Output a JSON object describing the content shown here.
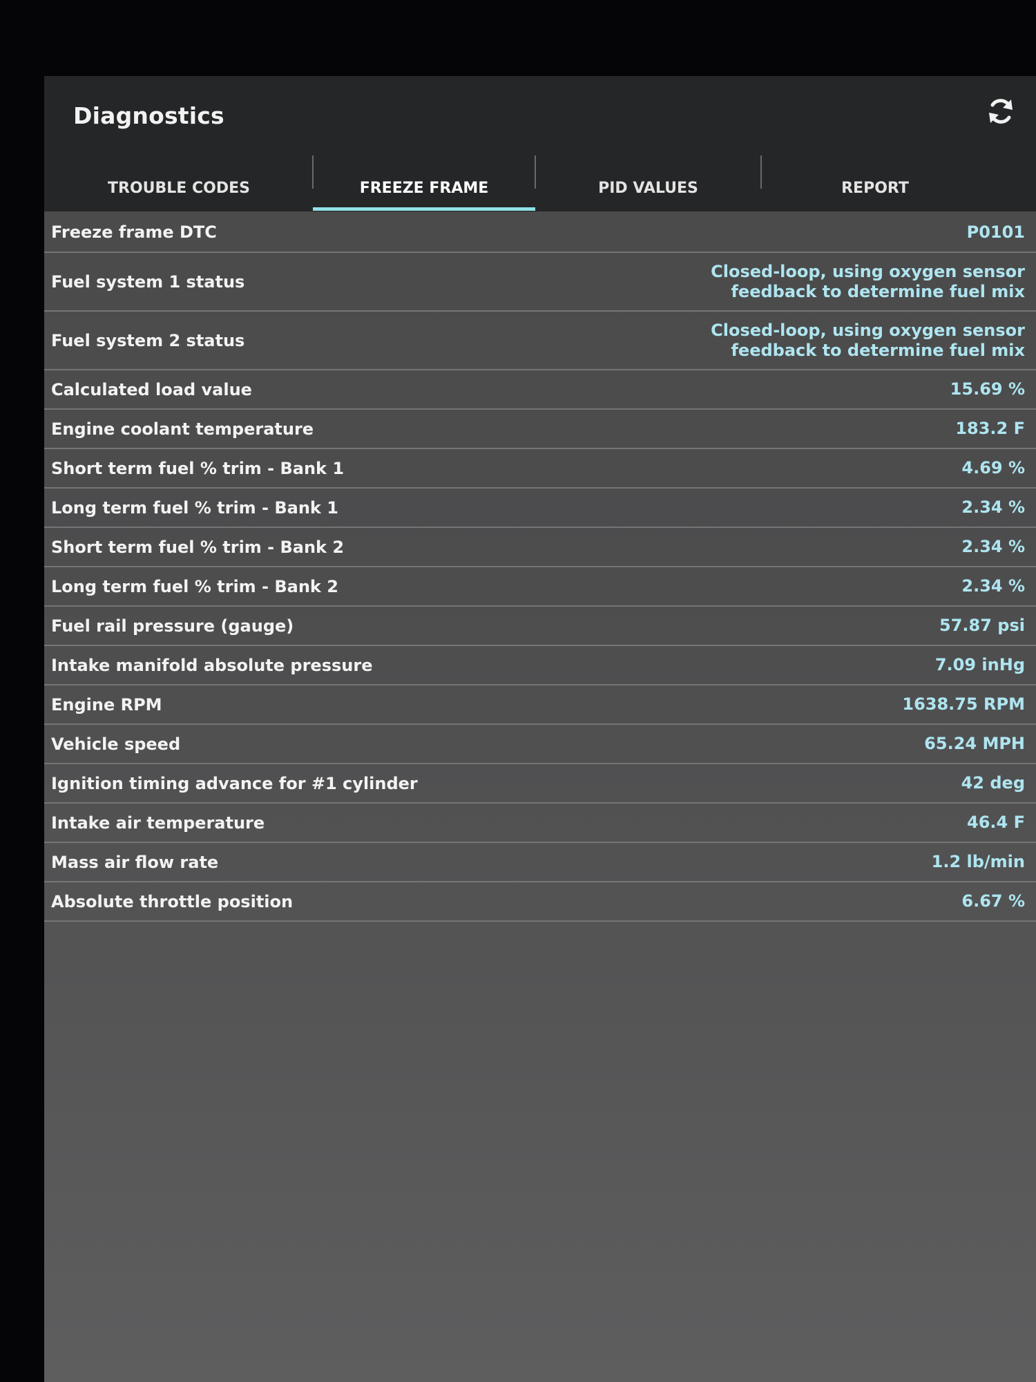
{
  "app": {
    "title": "Diagnostics",
    "refresh_icon": "refresh-icon",
    "accent_color": "#8fe3e8",
    "value_color": "#aee5f0"
  },
  "tabs": [
    {
      "label": "TROUBLE CODES",
      "active": false
    },
    {
      "label": "FREEZE FRAME",
      "active": true
    },
    {
      "label": "PID VALUES",
      "active": false
    },
    {
      "label": "REPORT",
      "active": false
    }
  ],
  "freeze_frame": [
    {
      "label": "Freeze frame DTC",
      "value": "P0101"
    },
    {
      "label": "Fuel system 1 status",
      "value": "Closed-loop, using oxygen sensor feedback to determine fuel mix"
    },
    {
      "label": "Fuel system 2 status",
      "value": "Closed-loop, using oxygen sensor feedback to determine fuel mix"
    },
    {
      "label": "Calculated load value",
      "value": "15.69 %"
    },
    {
      "label": "Engine coolant temperature",
      "value": "183.2 F"
    },
    {
      "label": "Short term fuel % trim - Bank 1",
      "value": "4.69 %"
    },
    {
      "label": "Long term fuel % trim - Bank 1",
      "value": "2.34 %"
    },
    {
      "label": "Short term fuel % trim - Bank 2",
      "value": "2.34 %"
    },
    {
      "label": "Long term fuel % trim - Bank 2",
      "value": "2.34 %"
    },
    {
      "label": "Fuel rail pressure (gauge)",
      "value": "57.87 psi"
    },
    {
      "label": "Intake manifold absolute pressure",
      "value": "7.09 inHg"
    },
    {
      "label": "Engine RPM",
      "value": "1638.75 RPM"
    },
    {
      "label": "Vehicle speed",
      "value": "65.24 MPH"
    },
    {
      "label": "Ignition timing advance for #1 cylinder",
      "value": "42 deg"
    },
    {
      "label": "Intake air temperature",
      "value": "46.4 F"
    },
    {
      "label": "Mass air flow rate",
      "value": "1.2 lb/min"
    },
    {
      "label": "Absolute throttle position",
      "value": "6.67 %"
    }
  ]
}
